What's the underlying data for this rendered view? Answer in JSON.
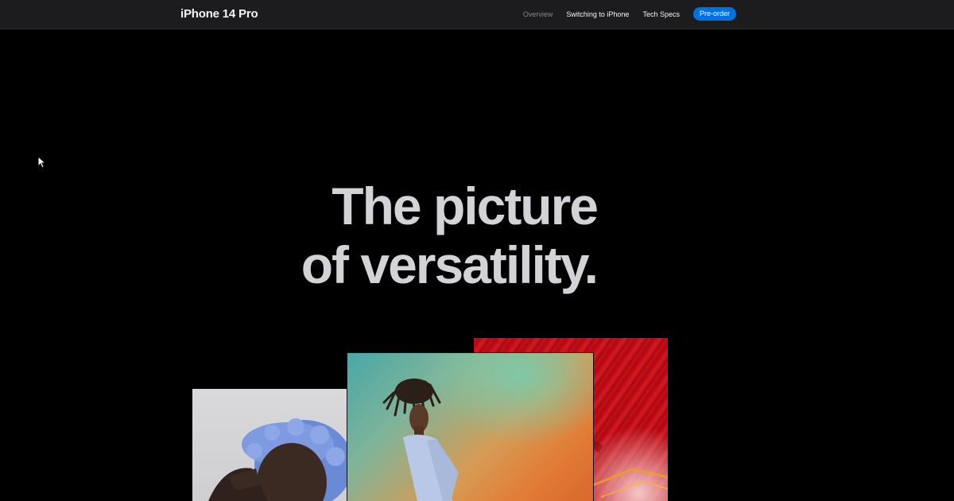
{
  "subnav": {
    "title": "iPhone 14 Pro",
    "links": [
      {
        "label": "Overview",
        "current": true
      },
      {
        "label": "Switching to iPhone",
        "current": false
      },
      {
        "label": "Tech Specs",
        "current": false
      }
    ],
    "cta_label": "Pre-order"
  },
  "hero": {
    "headline_line1": "The picture",
    "headline_line2": "of versatility."
  },
  "gallery": {
    "photos": [
      {
        "subject": "person-with-blue-braids-portrait"
      },
      {
        "subject": "person-in-white-shirt-on-colorful-background"
      },
      {
        "subject": "red-abstract-texture"
      }
    ]
  },
  "colors": {
    "nav_bg": "#1c1c1e",
    "accent": "#0071e3",
    "headline": "#d2d2d7",
    "page_bg": "#000000"
  }
}
